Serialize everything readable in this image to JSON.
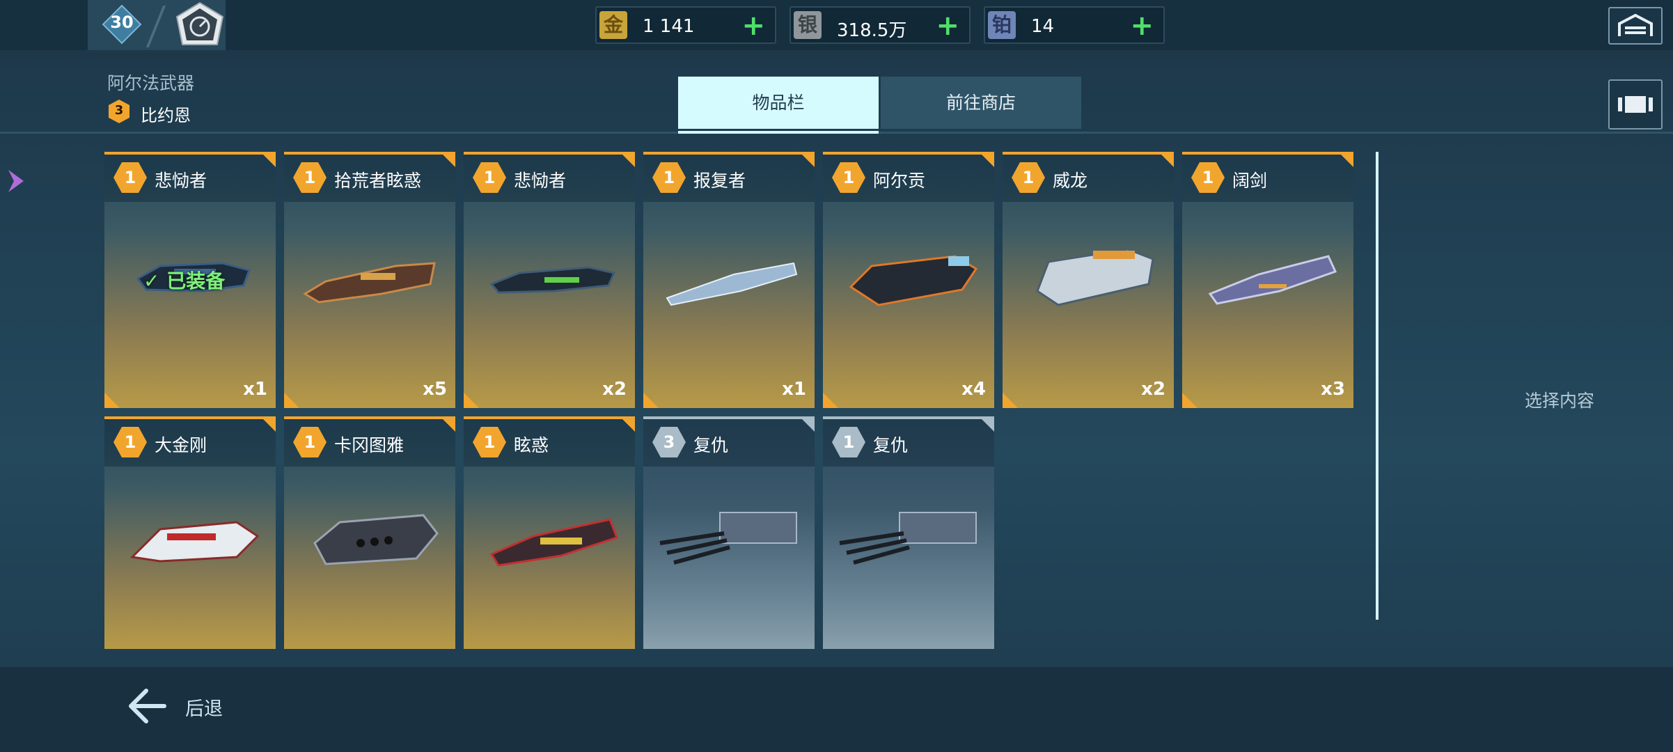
{
  "top_bar": {
    "level": "30",
    "currencies": [
      {
        "icon_text": "金",
        "value": "1 141",
        "icon": "gold-icon",
        "color": "#c9a43a"
      },
      {
        "icon_text": "银",
        "value": "318.5万",
        "icon": "silver-icon",
        "color": "#9aa3a8"
      },
      {
        "icon_text": "铂",
        "value": "14",
        "icon": "platinum-icon",
        "color": "#6f86b8"
      }
    ]
  },
  "header": {
    "category": "阿尔法武器",
    "robot_level": "3",
    "robot_name": "比约恩"
  },
  "tabs": [
    {
      "label": "物品栏",
      "active": true
    },
    {
      "label": "前往商店",
      "active": false
    }
  ],
  "items": [
    {
      "level": "1",
      "name": "悲恸者",
      "qty": "x1",
      "equipped": true,
      "rarity": "gold"
    },
    {
      "level": "1",
      "name": "拾荒者眩惑",
      "qty": "x5",
      "equipped": false,
      "rarity": "gold"
    },
    {
      "level": "1",
      "name": "悲恸者",
      "qty": "x2",
      "equipped": false,
      "rarity": "gold"
    },
    {
      "level": "1",
      "name": "报复者",
      "qty": "x1",
      "equipped": false,
      "rarity": "gold"
    },
    {
      "level": "1",
      "name": "阿尔贡",
      "qty": "x4",
      "equipped": false,
      "rarity": "gold"
    },
    {
      "level": "1",
      "name": "威龙",
      "qty": "x2",
      "equipped": false,
      "rarity": "gold"
    },
    {
      "level": "1",
      "name": "阔剑",
      "qty": "x3",
      "equipped": false,
      "rarity": "gold"
    },
    {
      "level": "1",
      "name": "大金刚",
      "qty": "",
      "equipped": false,
      "rarity": "gold"
    },
    {
      "level": "1",
      "name": "卡冈图雅",
      "qty": "",
      "equipped": false,
      "rarity": "gold"
    },
    {
      "level": "1",
      "name": "眩惑",
      "qty": "",
      "equipped": false,
      "rarity": "gold"
    },
    {
      "level": "3",
      "name": "复仇",
      "qty": "",
      "equipped": false,
      "rarity": "silver"
    },
    {
      "level": "1",
      "name": "复仇",
      "qty": "",
      "equipped": false,
      "rarity": "silver"
    }
  ],
  "equipped_label": "已装备",
  "right_panel": {
    "hint": "选择内容"
  },
  "bottom": {
    "back_label": "后退"
  }
}
